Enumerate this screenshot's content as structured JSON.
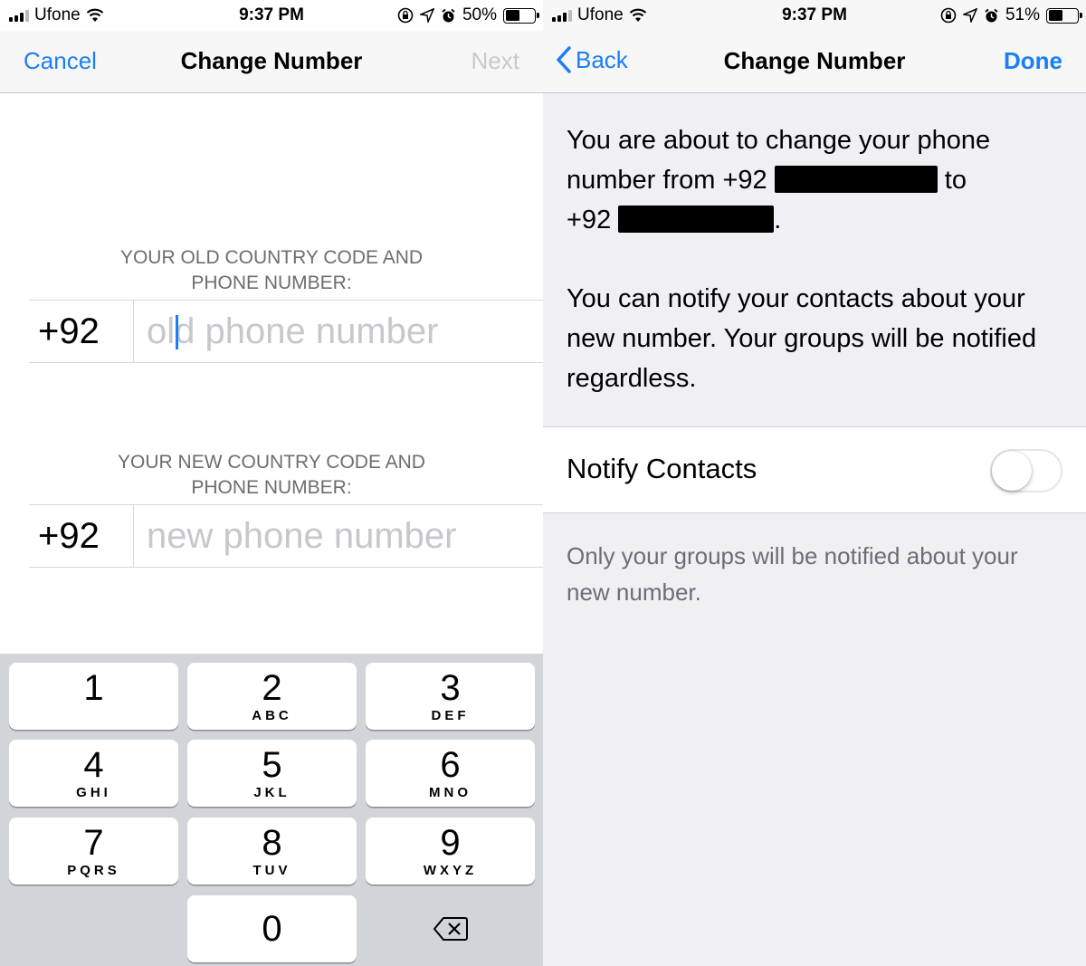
{
  "left": {
    "status": {
      "carrier": "Ufone",
      "time": "9:37 PM",
      "battery": "50%",
      "battery_level": 0.5
    },
    "nav": {
      "cancel": "Cancel",
      "title": "Change Number",
      "next": "Next"
    },
    "old_section": {
      "label_line1": "YOUR OLD COUNTRY CODE AND",
      "label_line2": "PHONE NUMBER:",
      "code": "+92",
      "placeholder": "old phone number"
    },
    "new_section": {
      "label_line1": "YOUR NEW COUNTRY CODE AND",
      "label_line2": "PHONE NUMBER:",
      "code": "+92",
      "placeholder": "new phone number"
    },
    "keypad": [
      {
        "num": "1",
        "letters": ""
      },
      {
        "num": "2",
        "letters": "ABC"
      },
      {
        "num": "3",
        "letters": "DEF"
      },
      {
        "num": "4",
        "letters": "GHI"
      },
      {
        "num": "5",
        "letters": "JKL"
      },
      {
        "num": "6",
        "letters": "MNO"
      },
      {
        "num": "7",
        "letters": "PQRS"
      },
      {
        "num": "8",
        "letters": "TUV"
      },
      {
        "num": "9",
        "letters": "WXYZ"
      },
      {
        "num": "0",
        "letters": ""
      }
    ],
    "delete_icon": "backspace-icon"
  },
  "right": {
    "status": {
      "carrier": "Ufone",
      "time": "9:37 PM",
      "battery": "51%",
      "battery_level": 0.51
    },
    "nav": {
      "back": "Back",
      "title": "Change Number",
      "done": "Done"
    },
    "message": {
      "line1": "You are about to change your phone",
      "line2_prefix": "number from +92",
      "line2_suffix": "to",
      "line3_prefix": "+92",
      "line3_suffix": "."
    },
    "notify_info": "You can notify your contacts about your new number. Your groups will be notified regardless.",
    "toggle": {
      "label": "Notify Contacts",
      "on": false
    },
    "footnote": "Only your groups will be notified about your new number."
  },
  "colors": {
    "accent": "#1a7ff5",
    "disabled": "#c9c9ce",
    "secondary_text": "#6d6d72",
    "keypad_bg": "#d1d4d9"
  }
}
